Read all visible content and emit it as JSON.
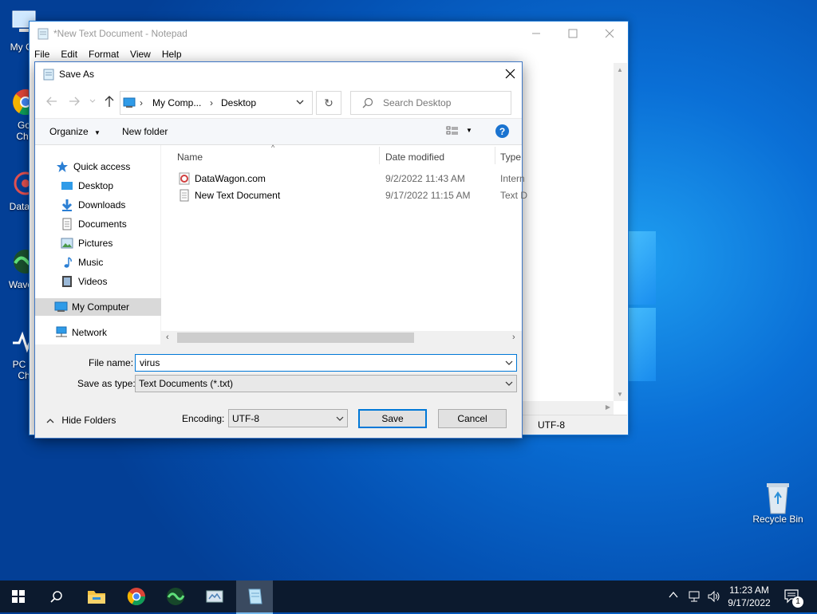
{
  "desktop": {
    "icons": [
      {
        "label": "My Co",
        "icon": "computer-icon"
      },
      {
        "label": "Go\nChr",
        "icon": "chrome-icon"
      },
      {
        "label": "DataW",
        "icon": "datawagon-icon"
      },
      {
        "label": "WaveB",
        "icon": "wavebrowser-icon"
      },
      {
        "label": "PC H\nCh",
        "icon": "pc-health-check-icon"
      }
    ],
    "recycle_bin": "Recycle Bin"
  },
  "notepad": {
    "title": "*New Text Document - Notepad",
    "menu": [
      "File",
      "Edit",
      "Format",
      "View",
      "Help"
    ],
    "status_encoding": "UTF-8"
  },
  "dialog": {
    "title": "Save As",
    "breadcrumb": [
      "My Comp...",
      "Desktop"
    ],
    "search_placeholder": "Search Desktop",
    "toolbar": {
      "organize": "Organize",
      "new_folder": "New folder"
    },
    "nav": {
      "quick_access": "Quick access",
      "items": [
        "Desktop",
        "Downloads",
        "Documents",
        "Pictures",
        "Music",
        "Videos"
      ],
      "my_computer": "My Computer",
      "network": "Network"
    },
    "columns": [
      "Name",
      "Date modified",
      "Type"
    ],
    "files": [
      {
        "name": "DataWagon.com",
        "date": "9/2/2022 11:43 AM",
        "type": "Intern",
        "icon": "internet-shortcut-icon"
      },
      {
        "name": "New Text Document",
        "date": "9/17/2022 11:15 AM",
        "type": "Text D",
        "icon": "text-file-icon"
      }
    ],
    "file_name_label": "File name:",
    "file_name_value": "virus",
    "save_type_label": "Save as type:",
    "save_type_value": "Text Documents (*.txt)",
    "hide_folders": "Hide Folders",
    "encoding_label": "Encoding:",
    "encoding_value": "UTF-8",
    "save_label": "Save",
    "cancel_label": "Cancel"
  },
  "taskbar": {
    "time": "11:23 AM",
    "date": "9/17/2022",
    "notification_count": "1"
  },
  "colors": {
    "accent": "#0078d7",
    "taskbar": "#0c1a2e",
    "desktop": "#0a6fd6"
  }
}
